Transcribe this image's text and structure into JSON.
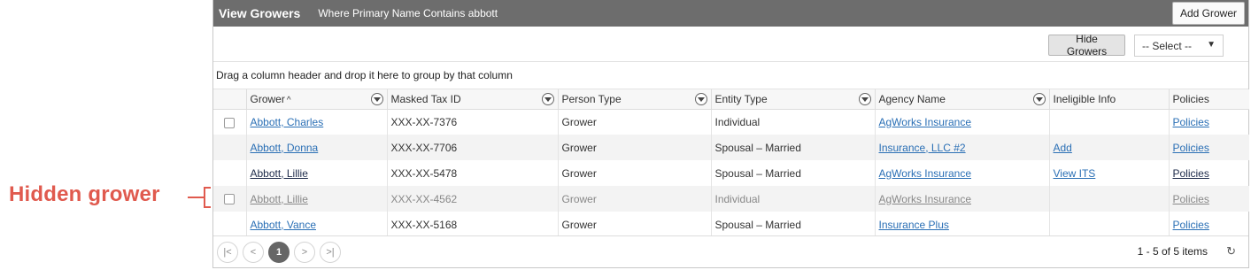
{
  "annotation": {
    "label": "Hidden grower"
  },
  "header": {
    "title": "View Growers",
    "criteria": "Where Primary Name Contains abbott",
    "add_button": "Add Grower"
  },
  "toolbar": {
    "hide_button": "Hide Growers",
    "select_value": "-- Select --"
  },
  "group_hint": "Drag a column header and drop it here to group by that column",
  "columns": {
    "grower": "Grower",
    "tax": "Masked Tax ID",
    "person": "Person Type",
    "entity": "Entity Type",
    "agency": "Agency Name",
    "ineligible": "Ineligible Info",
    "policies": "Policies"
  },
  "rows": [
    {
      "grower": "Abbott, Charles",
      "tax": "XXX-XX-7376",
      "person": "Grower",
      "entity": "Individual",
      "agency": "AgWorks Insurance",
      "ineligible": "",
      "policies": "Policies"
    },
    {
      "grower": "Abbott, Donna",
      "tax": "XXX-XX-7706",
      "person": "Grower",
      "entity": "Spousal – Married",
      "agency": "Insurance, LLC #2",
      "ineligible": "Add",
      "policies": "Policies"
    },
    {
      "grower": "Abbott, Lillie",
      "tax": "XXX-XX-5478",
      "person": "Grower",
      "entity": "Spousal – Married",
      "agency": "AgWorks Insurance",
      "ineligible": "View ITS",
      "policies": "Policies"
    },
    {
      "grower": "Abbott, Lillie",
      "tax": "XXX-XX-4562",
      "person": "Grower",
      "entity": "Individual",
      "agency": "AgWorks Insurance",
      "ineligible": "",
      "policies": "Policies"
    },
    {
      "grower": "Abbott, Vance",
      "tax": "XXX-XX-5168",
      "person": "Grower",
      "entity": "Spousal – Married",
      "agency": "Insurance Plus",
      "ineligible": "",
      "policies": "Policies"
    }
  ],
  "pager": {
    "current_page": "1",
    "info": "1 - 5 of 5 items"
  },
  "colors": {
    "header_bg": "#6d6d6d",
    "link": "#2a6fb5",
    "annotation": "#e05a4e"
  }
}
